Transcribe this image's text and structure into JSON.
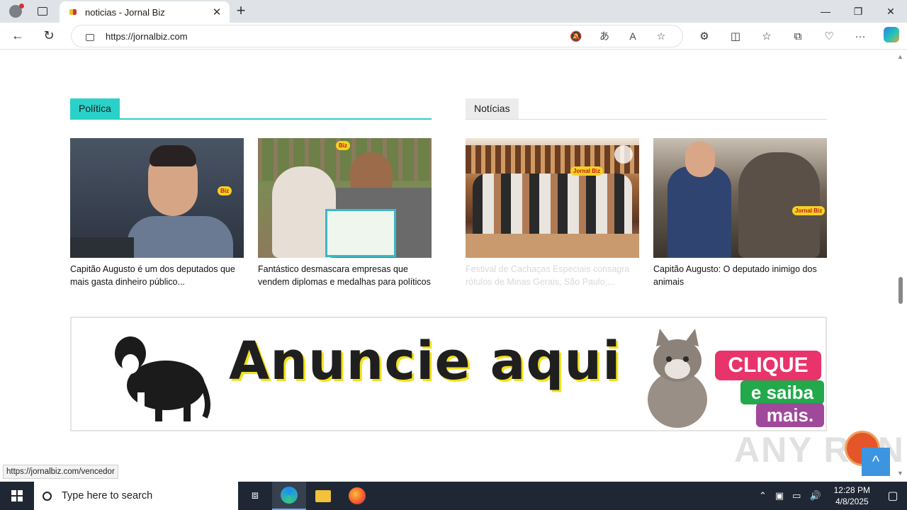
{
  "browser": {
    "tab_title": "noticias - Jornal Biz",
    "url": "https://jornalbiz.com",
    "status_url": "https://jornalbiz.com/vencedor",
    "new_tab_symbol": "+",
    "tab_close_symbol": "✕",
    "window_controls": [
      "—",
      "❐",
      "✕"
    ],
    "nav": {
      "back": "←",
      "refresh": "↻"
    },
    "omnibox_icons": [
      "🔕",
      "あ",
      "A",
      "☆"
    ],
    "toolbar_icons": [
      "⚙",
      "◫",
      "☆",
      "⧉",
      "♡",
      "···"
    ]
  },
  "page": {
    "sections": [
      {
        "label": "Política",
        "accent": "#2ad1c9"
      },
      {
        "label": "Notícias",
        "accent": "#ececec"
      }
    ],
    "cards": [
      {
        "caption": "Capitão Augusto é um dos deputados que mais gasta dinheiro público...",
        "badge": "Biz"
      },
      {
        "caption": "Fantástico desmascara empresas que vendem diplomas e medalhas para políticos",
        "badge": "Biz"
      },
      {
        "caption": "Festival de Cachaças Especiais consagra rótulos de Minas Gerais, São Paulo,...",
        "badge": "Jornal Biz"
      },
      {
        "caption": "Capitão Augusto: O deputado inimigo dos animais",
        "badge": "Jornal Biz"
      }
    ],
    "banner": {
      "headline": "Anuncie aqui",
      "cta_line1": "CLIQUE",
      "cta_line2": "e saiba",
      "cta_line3": "mais."
    },
    "back_to_top": "^",
    "watermark": "ANY RUN"
  },
  "taskbar": {
    "search_placeholder": "Type here to search",
    "time": "12:28 PM",
    "date": "4/8/2025"
  },
  "colors": {
    "accent_teal": "#2ad1c9",
    "taskbar_bg": "#1f2734",
    "back_to_top_bg": "#3d95df"
  }
}
